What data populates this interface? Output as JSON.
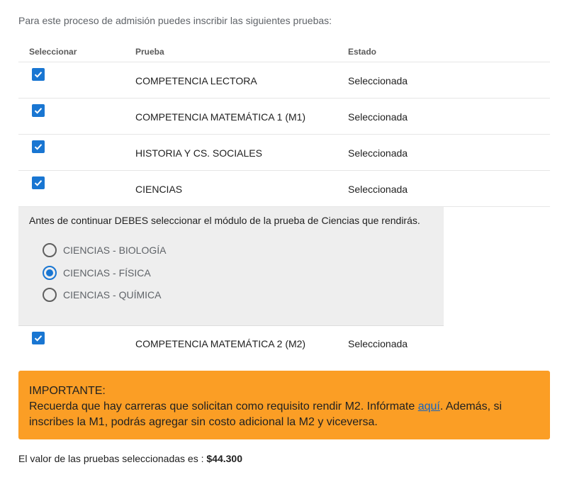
{
  "intro": "Para este proceso de admisión puedes inscribir las siguientes pruebas:",
  "table": {
    "headers": {
      "select": "Seleccionar",
      "test": "Prueba",
      "status": "Estado"
    },
    "rows": [
      {
        "name": "COMPETENCIA LECTORA",
        "status": "Seleccionada",
        "checked": true
      },
      {
        "name": "COMPETENCIA MATEMÁTICA 1 (M1)",
        "status": "Seleccionada",
        "checked": true
      },
      {
        "name": "HISTORIA Y CS. SOCIALES",
        "status": "Seleccionada",
        "checked": true
      },
      {
        "name": "CIENCIAS",
        "status": "Seleccionada",
        "checked": true
      }
    ],
    "last_row": {
      "name": "COMPETENCIA MATEMÁTICA 2 (M2)",
      "status": "Seleccionada",
      "checked": true
    }
  },
  "module": {
    "prompt": "Antes de continuar DEBES seleccionar el módulo de la prueba de Ciencias que rendirás.",
    "options": [
      {
        "label": "CIENCIAS - BIOLOGÍA",
        "selected": false
      },
      {
        "label": "CIENCIAS - FÍSICA",
        "selected": true
      },
      {
        "label": "CIENCIAS - QUÍMICA",
        "selected": false
      }
    ]
  },
  "important": {
    "title": "IMPORTANTE:",
    "text_before_link": "Recuerda que hay carreras que solicitan como requisito rendir M2. Infórmate ",
    "link_text": "aquí",
    "text_after_link": ". Además, si inscribes la M1, podrás agregar sin costo adicional la M2 y viceversa."
  },
  "total": {
    "label": "El valor de las pruebas seleccionadas es : ",
    "value": "$44.300"
  },
  "colors": {
    "accent": "#1976d2",
    "warning": "#fb9e25",
    "link": "#1565c0"
  },
  "icons": {
    "checkbox": "checkbox-checked-icon",
    "radio": "radio-icon"
  }
}
